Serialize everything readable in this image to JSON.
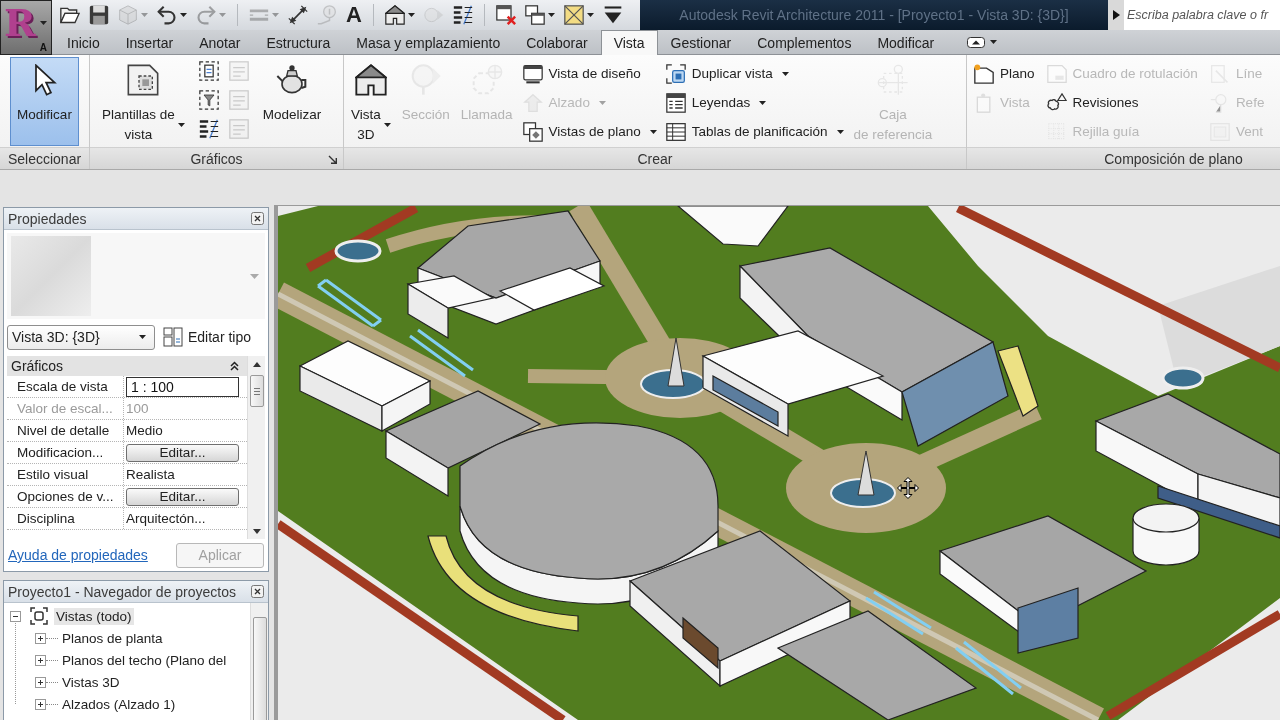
{
  "app_button": {
    "logo": "R",
    "keytip": "A"
  },
  "quick_access": [
    {
      "tools": [
        {
          "kind": "open",
          "disabled": false,
          "menu": false
        },
        {
          "kind": "save",
          "disabled": false,
          "menu": false
        },
        {
          "kind": "sync",
          "disabled": true,
          "menu": true
        },
        {
          "kind": "undo",
          "disabled": false,
          "menu": true
        },
        {
          "kind": "redo",
          "disabled": true,
          "menu": true
        }
      ]
    },
    {
      "tools": [
        {
          "kind": "align",
          "disabled": true,
          "menu": true
        },
        {
          "kind": "dimension",
          "disabled": false,
          "menu": false
        },
        {
          "kind": "tag",
          "disabled": true,
          "menu": false
        },
        {
          "kind": "text",
          "glyph": "A",
          "disabled": false,
          "menu": false
        }
      ]
    },
    {
      "tools": [
        {
          "kind": "house",
          "disabled": false,
          "menu": true
        },
        {
          "kind": "section",
          "disabled": true,
          "menu": false
        },
        {
          "kind": "thin_lines",
          "disabled": false,
          "menu": false
        }
      ]
    },
    {
      "tools": [
        {
          "kind": "close_windows",
          "disabled": false,
          "menu": false
        },
        {
          "kind": "switch_windows",
          "disabled": false,
          "menu": true
        },
        {
          "kind": "tile_windows",
          "disabled": false,
          "menu": true
        },
        {
          "kind": "customize",
          "disabled": false,
          "menu": false
        }
      ]
    }
  ],
  "window_title": "Autodesk Revit Architecture 2011 - [Proyecto1 - Vista 3D: {3D}]",
  "search": {
    "placeholder": "Escriba palabra clave o fr"
  },
  "tabs": [
    {
      "label": "Inicio",
      "selected": false
    },
    {
      "label": "Insertar",
      "selected": false
    },
    {
      "label": "Anotar",
      "selected": false
    },
    {
      "label": "Estructura",
      "selected": false
    },
    {
      "label": "Masa y emplazamiento",
      "selected": false
    },
    {
      "label": "Colaborar",
      "selected": false
    },
    {
      "label": "Vista",
      "selected": true
    },
    {
      "label": "Gestionar",
      "selected": false
    },
    {
      "label": "Complementos",
      "selected": false
    },
    {
      "label": "Modificar",
      "selected": false
    }
  ],
  "ribbon": {
    "panels": [
      {
        "title": "Seleccionar",
        "launcher": false,
        "tools": [
          {
            "kind": "large",
            "lines": [
              "Modificar"
            ],
            "active": true,
            "disabled": false,
            "menu": false
          }
        ]
      },
      {
        "title": "Gráficos",
        "launcher": true,
        "tools": [
          {
            "kind": "large",
            "lines": [
              "Plantillas de",
              "vista"
            ],
            "active": false,
            "disabled": false,
            "menu": true
          },
          {
            "kind": "icon_grid",
            "icons": [
              {
                "disabled": false
              },
              {
                "disabled": true
              },
              {
                "disabled": false
              },
              {
                "disabled": true
              },
              {
                "disabled": false
              },
              {
                "disabled": true
              }
            ]
          },
          {
            "kind": "large",
            "lines": [
              "Modelizar"
            ],
            "active": false,
            "disabled": false,
            "menu": false
          }
        ]
      },
      {
        "title": "Crear",
        "launcher": false,
        "tools": [
          {
            "kind": "large",
            "lines": [
              "Vista",
              "3D"
            ],
            "active": false,
            "disabled": false,
            "menu": true
          },
          {
            "kind": "large",
            "lines": [
              "Sección"
            ],
            "active": false,
            "disabled": true,
            "menu": false
          },
          {
            "kind": "large",
            "lines": [
              "Llamada"
            ],
            "active": false,
            "disabled": true,
            "menu": false
          },
          {
            "kind": "column",
            "items": [
              {
                "label": "Vista de diseño",
                "disabled": false,
                "menu": false
              },
              {
                "label": "Alzado",
                "disabled": true,
                "menu": true
              },
              {
                "label": "Vistas de plano",
                "disabled": false,
                "menu": true
              }
            ]
          },
          {
            "kind": "column",
            "items": [
              {
                "label": "Duplicar vista",
                "disabled": false,
                "menu": true
              },
              {
                "label": "Leyendas",
                "disabled": false,
                "menu": true
              },
              {
                "label": "Tablas de planificación",
                "disabled": false,
                "menu": true
              }
            ]
          },
          {
            "kind": "large",
            "lines": [
              "Caja",
              "de referencia"
            ],
            "active": false,
            "disabled": true,
            "menu": false
          }
        ]
      },
      {
        "title": "Composición de plano",
        "launcher": false,
        "tools": [
          {
            "kind": "column",
            "items": [
              {
                "label": "Plano",
                "disabled": false,
                "menu": false
              },
              {
                "label": "Vista",
                "disabled": true,
                "menu": false
              }
            ]
          },
          {
            "kind": "column",
            "items": [
              {
                "label": "Cuadro de rotulación",
                "disabled": true,
                "menu": false
              },
              {
                "label": "Revisiones",
                "disabled": false,
                "menu": false
              },
              {
                "label": "Rejilla guía",
                "disabled": true,
                "menu": false
              }
            ]
          },
          {
            "kind": "column",
            "items": [
              {
                "label": "Líne",
                "disabled": true,
                "menu": false
              },
              {
                "label": "Refe",
                "disabled": true,
                "menu": false
              },
              {
                "label": "Vent",
                "disabled": true,
                "menu": false
              }
            ]
          }
        ]
      }
    ]
  },
  "properties": {
    "title": "Propiedades",
    "type": "Vista 3D: {3D}",
    "edit_type": "Editar tipo",
    "group": {
      "title": "Gráficos",
      "expanded": true
    },
    "rows": [
      {
        "name": "Escala de vista",
        "value": "1 : 100",
        "kind": "input",
        "disabled": false
      },
      {
        "name": "Valor de escal...",
        "value": "100",
        "kind": "text",
        "disabled": true
      },
      {
        "name": "Nivel de detalle",
        "value": "Medio",
        "kind": "text",
        "disabled": false
      },
      {
        "name": "Modificacion...",
        "value": "Editar...",
        "kind": "button",
        "disabled": false
      },
      {
        "name": "Estilo visual",
        "value": "Realista",
        "kind": "text",
        "disabled": false
      },
      {
        "name": "Opciones de v...",
        "value": "Editar...",
        "kind": "button",
        "disabled": false
      },
      {
        "name": "Disciplina",
        "value": "Arquitectón...",
        "kind": "text",
        "disabled": false
      }
    ],
    "help_link": "Ayuda de propiedades",
    "apply": {
      "label": "Aplicar",
      "disabled": true
    }
  },
  "project_browser": {
    "title": "Proyecto1 - Navegador de proyectos",
    "tree": [
      {
        "label": "Vistas (todo)",
        "expanded": true,
        "selected": true,
        "children": [
          {
            "label": "Planos de planta",
            "expanded": false,
            "selected": false
          },
          {
            "label": "Planos del techo (Plano del",
            "expanded": false,
            "selected": false
          },
          {
            "label": "Vistas 3D",
            "expanded": false,
            "selected": false
          },
          {
            "label": "Alzados (Alzado 1)",
            "expanded": false,
            "selected": false
          }
        ]
      }
    ]
  }
}
